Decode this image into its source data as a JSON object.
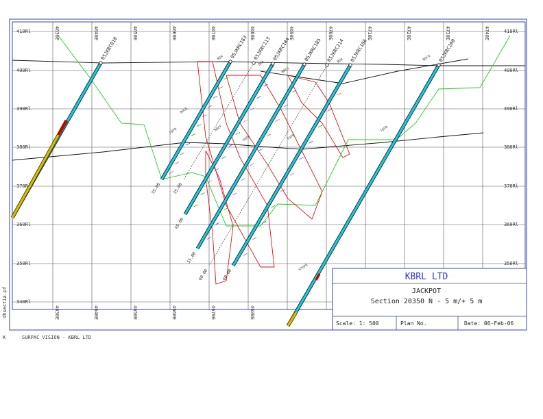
{
  "section_frame": {
    "rl_labels": [
      "410Rl",
      "400Rl",
      "390Rl",
      "380Rl",
      "370Rl",
      "360Rl",
      "350Rl",
      "340Rl"
    ],
    "top_easting_labels": [
      "4630E",
      "4640E",
      "4650E",
      "4660E",
      "4670E",
      "4680E",
      "4690E",
      "4700E",
      "4710E",
      "4720E",
      "4730E",
      "4740E"
    ],
    "bottom_easting_labels": [
      "4630E",
      "4640E",
      "4650E",
      "4660E",
      "4670E",
      "4680E"
    ]
  },
  "drillholes": [
    {
      "name": "05JKRC010"
    },
    {
      "name": "05JKRC183",
      "depth": "35.00"
    },
    {
      "name": "05JKRC213",
      "depth": "35.00"
    },
    {
      "name": "05JKRC184",
      "depth": "45.00"
    },
    {
      "name": "05JKRC185",
      "depth": "55.00"
    },
    {
      "name": "05JKRC214",
      "depth": "60.00"
    },
    {
      "name": "05JKRC186",
      "depth": "60.00"
    },
    {
      "name": "05JKRC200"
    }
  ],
  "annotations": {
    "boa": "BOA",
    "bocf": "BOCF",
    "bocg": "BOCG",
    "tofr": "TOFR",
    "stope": "STOPE"
  },
  "title_block": {
    "company": "KBRL LTD",
    "project": "JACKPOT",
    "section": "Section 20350 N - 5 m/+ 5 m",
    "scale": "Scale: 1: 500",
    "plan_no": "Plan No.",
    "date": "Date: 06-Feb-06"
  },
  "footer": {
    "software": "SURPAC_VISION - KBRL LTD",
    "side_label": "dhsectia.pf",
    "corner_mark": "K"
  },
  "colors": {
    "frame_blue": "#3344bb",
    "grid_line": "#555555",
    "drillhole_cyan": "#22c7d0",
    "oxide_yellow": "#d4c000",
    "high_grade_red": "#cc0000",
    "outline_red": "#dd1111",
    "base_oxidation_green": "#22cc22",
    "surface_black": "#111111"
  }
}
